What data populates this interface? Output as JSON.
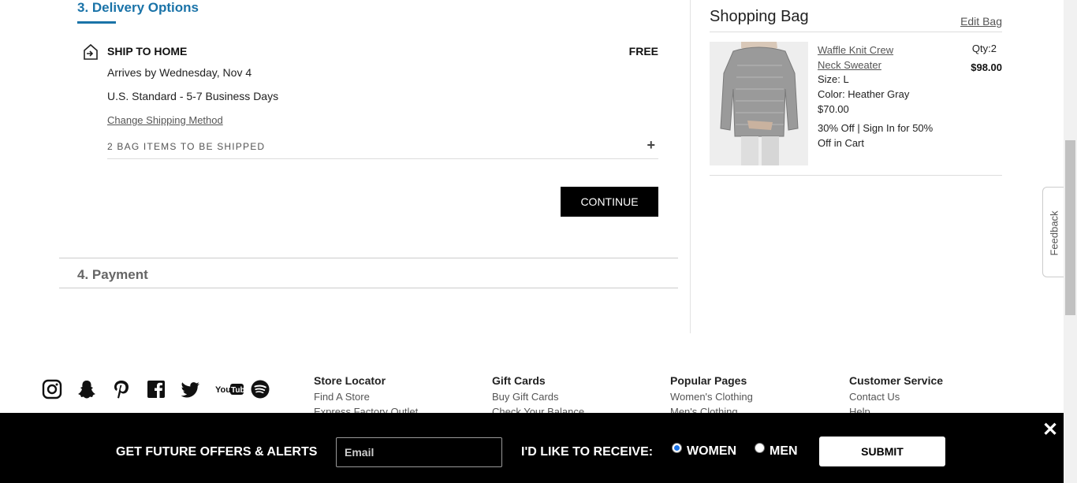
{
  "delivery": {
    "step_title": "3. Delivery Options",
    "ship_title": "SHIP TO HOME",
    "ship_price": "FREE",
    "arrives": "Arrives by Wednesday, Nov 4",
    "method": "U.S. Standard - 5-7 Business Days",
    "change_link": "Change Shipping Method",
    "bag_items": "2 BAG ITEMS TO BE SHIPPED",
    "expand_icon": "plus-icon",
    "continue_label": "CONTINUE"
  },
  "payment": {
    "step_title": "4. Payment"
  },
  "bag": {
    "title": "Shopping Bag",
    "edit_label": "Edit Bag",
    "item": {
      "name": "Waffle Knit Crew Neck Sweater",
      "size": "Size: L",
      "color": "Color: Heather Gray",
      "price": "$70.00",
      "promo": "30% Off | Sign In for 50% Off in Cart",
      "qty": "Qty:2",
      "total": "$98.00"
    }
  },
  "feedback": {
    "label": "Feedback"
  },
  "social": [
    "instagram-icon",
    "snapchat-icon",
    "pinterest-icon",
    "facebook-icon",
    "twitter-icon",
    "youtube-icon",
    "spotify-icon"
  ],
  "footer": {
    "col1": {
      "heading": "Store Locator",
      "links": [
        "Find A Store",
        "Express Factory Outlet"
      ]
    },
    "col2": {
      "heading": "Gift Cards",
      "links": [
        "Buy Gift Cards",
        "Check Your Balance"
      ]
    },
    "col3": {
      "heading": "Popular Pages",
      "links": [
        "Women's Clothing",
        "Men's Clothing"
      ]
    },
    "col4": {
      "heading": "Customer Service",
      "links": [
        "Contact Us",
        "Help"
      ]
    }
  },
  "signup": {
    "offers_text": "GET FUTURE OFFERS & ALERTS",
    "email_placeholder": "Email",
    "receive_text": "I'D LIKE TO RECEIVE:",
    "option_women": "WOMEN",
    "option_men": "MEN",
    "selected": "WOMEN",
    "submit_label": "SUBMIT",
    "close_icon": "close-icon"
  },
  "colors": {
    "accent": "#1a73a8",
    "bar_bg": "#000000"
  }
}
